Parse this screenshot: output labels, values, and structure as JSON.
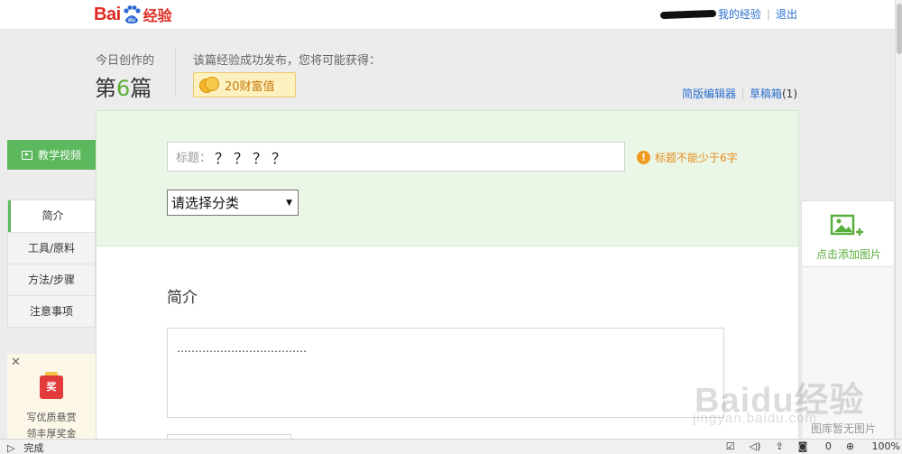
{
  "topbar": {
    "logo_latin": "Bai",
    "logo_du": "du",
    "logo_cn": "经验",
    "my_exp": "我的经验",
    "logout": "退出"
  },
  "header": {
    "today_label": "今日创作的",
    "today_prefix": "第",
    "today_num": "6",
    "today_suffix": "篇",
    "publish_label": "该篇经验成功发布，您将可能获得：",
    "reward_text": "20财富值",
    "simple_editor": "简版编辑器",
    "drafts_label": "草稿箱",
    "drafts_count": "(1)"
  },
  "form": {
    "title_label": "标题：",
    "title_value": "？？？？",
    "title_warning": "标题不能少于6字",
    "category_placeholder": "请选择分类",
    "intro_heading": "简介",
    "intro_value": "………………………………"
  },
  "left": {
    "video_button": "教学视频",
    "nav": [
      "简介",
      "工具/原料",
      "方法/步骤",
      "注意事项"
    ],
    "promo_badge": "奖",
    "promo_line1": "写优质悬赏",
    "promo_line2": "领丰厚奖金"
  },
  "right": {
    "add_image": "点击添加图片",
    "panel_hint": "图库暂无图片"
  },
  "watermark": {
    "brand": "Baidu经验",
    "url": "jingyan.baidu.com"
  },
  "statusbar": {
    "status": "完成",
    "count": "0",
    "zoom": "100%"
  },
  "colors": {
    "accent_green": "#5cb85c",
    "brand_red": "#de2a20",
    "link_blue": "#2a6fcd",
    "warning_orange": "#e58a1c"
  }
}
